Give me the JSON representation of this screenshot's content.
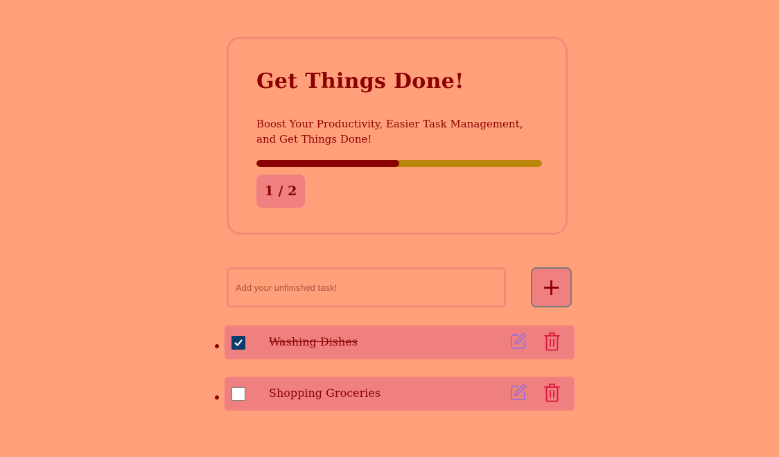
{
  "header": {
    "title": "Get Things Done!",
    "subtitle": "Boost Your Productivity, Easier Task Management, and Get Things Done!"
  },
  "progress": {
    "completed": 1,
    "total": 2,
    "fraction": 0.5,
    "label": "1 / 2"
  },
  "new_task": {
    "placeholder": "Add your unfinished task!",
    "value": "",
    "add_label": "+"
  },
  "tasks": [
    {
      "text": "Washing Dishes",
      "completed": true
    },
    {
      "text": "Shopping Groceries",
      "completed": false
    }
  ],
  "icons": {
    "checkmark": "check-icon",
    "edit": "pencil-icon",
    "delete": "trash-icon"
  },
  "colors": {
    "background": "#ffa07a",
    "accent": "#8b0000",
    "progress_track": "#b8860b",
    "item_background": "#f08080",
    "icon_edit": "#9370db",
    "icon_delete": "#dc143c",
    "checkbox_checked": "#0b3d6a"
  }
}
